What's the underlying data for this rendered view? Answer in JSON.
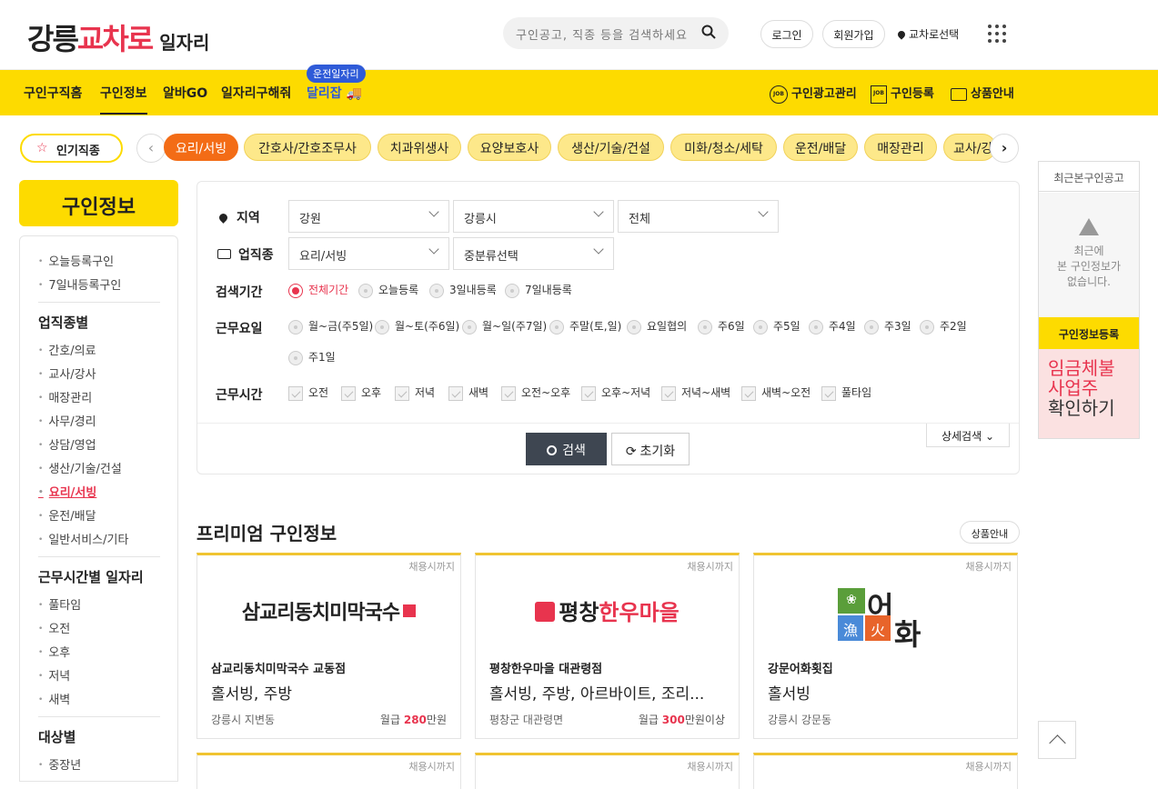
{
  "header": {
    "logo": {
      "part1": "강릉",
      "part2": "교차로",
      "part3": "일자리"
    },
    "search_placeholder": "구인공고, 직종 등을 검색하세요",
    "login": "로그인",
    "signup": "회원가입",
    "region": "교차로선택"
  },
  "nav": {
    "items": [
      "구인구직홈",
      "구인정보",
      "알바GO",
      "일자리구해줘",
      "달리잡"
    ],
    "badge": "운전일자리",
    "right": [
      "구인광고관리",
      "구인등록",
      "상품안내"
    ]
  },
  "categories": {
    "popular": "인기직종",
    "chips": [
      "요리/서빙",
      "간호사/간호조무사",
      "치과위생사",
      "요양보호사",
      "생산/기술/건설",
      "미화/청소/세탁",
      "운전/배달",
      "매장관리",
      "교사/강사"
    ]
  },
  "sidebar": {
    "title": "구인정보",
    "recent": [
      "오늘등록구인",
      "7일내등록구인"
    ],
    "by_job_title": "업직종별",
    "jobs": [
      "간호/의료",
      "교사/강사",
      "매장관리",
      "사무/경리",
      "상담/영업",
      "생산/기술/건설",
      "요리/서빙",
      "운전/배달",
      "일반서비스/기타"
    ],
    "by_time_title": "근무시간별 일자리",
    "times": [
      "풀타임",
      "오전",
      "오후",
      "저녁",
      "새벽"
    ],
    "by_target_title": "대상별",
    "targets": [
      "중장년"
    ]
  },
  "filter": {
    "region_label": "지역",
    "region": [
      "강원",
      "강릉시",
      "전체"
    ],
    "job_label": "업직종",
    "job": [
      "요리/서빙",
      "중분류선택"
    ],
    "period_label": "검색기간",
    "periods": [
      "전체기간",
      "오늘등록",
      "3일내등록",
      "7일내등록"
    ],
    "days_label": "근무요일",
    "days": [
      "월~금(주5일)",
      "월~토(주6일)",
      "월~일(주7일)",
      "주말(토,일)",
      "요일협의",
      "주6일",
      "주5일",
      "주4일",
      "주3일",
      "주2일",
      "주1일"
    ],
    "hours_label": "근무시간",
    "hours": [
      "오전",
      "오후",
      "저녁",
      "새벽",
      "오전~오후",
      "오후~저녁",
      "저녁~새벽",
      "새벽~오전",
      "풀타임"
    ],
    "search_btn": "검색",
    "reset_btn": "초기화",
    "more_btn": "상세검색"
  },
  "recent_panel": {
    "title": "최근본구인공고",
    "empty": [
      "최근에",
      "본 구인정보가",
      "없습니다."
    ],
    "register": "구인정보등록",
    "ad": [
      "임금체불",
      "사업주",
      "확인하기"
    ]
  },
  "premium": {
    "title": "프리미엄 구인정보",
    "info_btn": "상품안내",
    "cards": [
      {
        "due": "채용시까지",
        "logo": "삼교리동치미막국수",
        "name": "삼교리동치미막국수 교동점",
        "job": "홀서빙, 주방",
        "loc": "강릉시 지변동",
        "pay_label": "월급",
        "pay": "280",
        "pay_unit": "만원"
      },
      {
        "due": "채용시까지",
        "logo_a": "평창",
        "logo_b": "한우마을",
        "name": "평창한우마을 대관령점",
        "job": "홀서빙, 주방, 아르바이트, 조리...",
        "loc": "평창군 대관령면",
        "pay_label": "월급",
        "pay": "300",
        "pay_unit": "만원이상"
      },
      {
        "due": "채용시까지",
        "logo_a": "어",
        "logo_b": "화",
        "logo_c": "漁",
        "logo_d": "火",
        "name": "강문어화횟집",
        "job": "홀서빙",
        "loc": "강릉시 강문동",
        "pay_label": "",
        "pay": "",
        "pay_unit": ""
      }
    ],
    "row2_due": [
      "채용시까지",
      "채용시까지",
      "채용시까지"
    ]
  }
}
